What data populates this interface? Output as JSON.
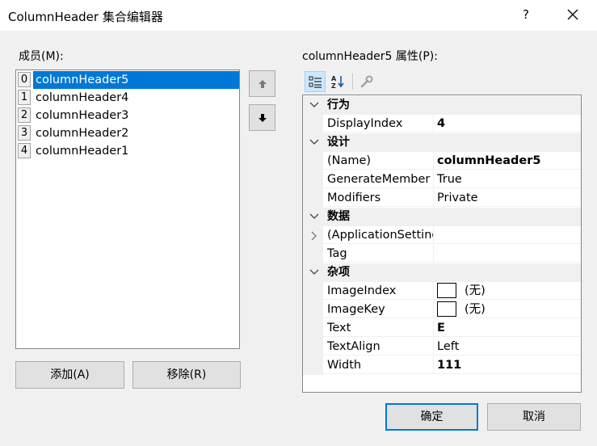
{
  "window": {
    "title": "ColumnHeader 集合编辑器",
    "help": "?",
    "close_icon": "close-icon"
  },
  "members": {
    "label": "成员(M):",
    "items": [
      {
        "index": "0",
        "name": "columnHeader5",
        "selected": true
      },
      {
        "index": "1",
        "name": "columnHeader4"
      },
      {
        "index": "2",
        "name": "columnHeader3"
      },
      {
        "index": "3",
        "name": "columnHeader2"
      },
      {
        "index": "4",
        "name": "columnHeader1"
      }
    ],
    "move_up_icon": "arrow-up-icon",
    "move_down_icon": "arrow-down-icon",
    "add_label": "添加(A)",
    "remove_label": "移除(R)"
  },
  "properties": {
    "label": "columnHeader5 属性(P):",
    "toolbar": {
      "categorized_icon": "categorized-icon",
      "alphabetical_icon": "sort-alphabetical-icon",
      "property_pages_icon": "wrench-icon"
    },
    "categories": [
      {
        "name": "行为",
        "props": [
          {
            "name": "DisplayIndex",
            "value": "4",
            "bold": true
          }
        ]
      },
      {
        "name": "设计",
        "props": [
          {
            "name": "(Name)",
            "value": "columnHeader5",
            "bold": true
          },
          {
            "name": "GenerateMember",
            "value": "True"
          },
          {
            "name": "Modifiers",
            "value": "Private"
          }
        ]
      },
      {
        "name": "数据",
        "props": [
          {
            "name": "(ApplicationSettings)",
            "value": "",
            "expandable": true
          },
          {
            "name": "Tag",
            "value": ""
          }
        ]
      },
      {
        "name": "杂项",
        "props": [
          {
            "name": "ImageIndex",
            "value": "(无)",
            "swatch": true
          },
          {
            "name": "ImageKey",
            "value": "(无)",
            "swatch": true
          },
          {
            "name": "Text",
            "value": "E",
            "bold": true
          },
          {
            "name": "TextAlign",
            "value": "Left"
          },
          {
            "name": "Width",
            "value": "111",
            "bold": true
          }
        ]
      }
    ]
  },
  "footer": {
    "ok_label": "确定",
    "cancel_label": "取消"
  },
  "colors": {
    "selection": "#0078d7",
    "default_button_border": "#0078d7",
    "dialog_background": "#f0f0f0"
  }
}
